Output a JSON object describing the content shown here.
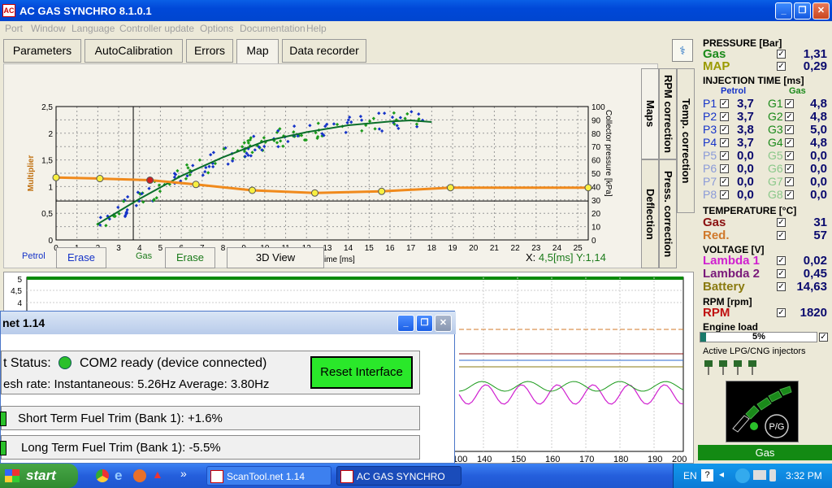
{
  "window": {
    "title": "AC GAS SYNCHRO  8.1.0.1",
    "minimize": "_",
    "maximize": "❐",
    "close": "✕"
  },
  "menu": [
    "Port",
    "Window",
    "Language",
    "Controller update",
    "Options",
    "Documentation",
    "Help"
  ],
  "tabs": [
    "Parameters",
    "AutoCalibration",
    "Errors",
    "Map",
    "Data recorder"
  ],
  "vertical_tabs": {
    "maps": "Maps",
    "rpm": "RPM correction",
    "temp": "Temp. correction",
    "press": "Press. correction",
    "deflection": "Deflection"
  },
  "bottom_controls": {
    "petrol_label": "Petrol",
    "petrol_erase": "Erase",
    "gas_label": "Gas",
    "gas_erase": "Erase",
    "view3d": "3D View",
    "x_label": "X:",
    "x_value": "4,5[ms]",
    "y_value": "Y:1,14"
  },
  "chart_data": {
    "type": "scatter",
    "xlabel": "Injection time [ms]",
    "ylabel": "Multiplier",
    "y2label": "Collector pressure [kPa]",
    "xlim": [
      0,
      25.5
    ],
    "ylim": [
      0,
      2.5
    ],
    "y2lim": [
      0,
      100
    ],
    "x_ticks": [
      0,
      1,
      2,
      3,
      4,
      5,
      6,
      7,
      8,
      9,
      10,
      11,
      12,
      13,
      14,
      15,
      16,
      17,
      18,
      19,
      20,
      21,
      22,
      23,
      24,
      25
    ],
    "y_ticks": [
      "0",
      "0,5",
      "1",
      "1,5",
      "2",
      "2,5"
    ],
    "y2_ticks": [
      0,
      10,
      20,
      30,
      40,
      50,
      60,
      70,
      80,
      90,
      100
    ],
    "multiplier_curve": {
      "x": [
        0,
        2.1,
        4.5,
        6.7,
        9.4,
        12.4,
        15.6,
        18.9,
        25.5
      ],
      "y": [
        1.17,
        1.15,
        1.12,
        1.04,
        0.93,
        0.88,
        0.91,
        0.98,
        0.98
      ],
      "points_x": [
        0,
        2.1,
        4.5,
        6.7,
        9.4,
        12.4,
        15.6,
        18.9,
        25.5
      ],
      "selected_index": 2
    },
    "pressure_curve": {
      "x": [
        2,
        4,
        6,
        8,
        10,
        12,
        14,
        16,
        17,
        18
      ],
      "y": [
        0.3,
        0.77,
        1.2,
        1.55,
        1.85,
        2.02,
        2.15,
        2.22,
        2.24,
        2.21
      ]
    },
    "cursor": {
      "x": 3.7,
      "y": 0.73
    },
    "colors": {
      "multiplier": "#f08a1c",
      "pressure_line": "#0a6e2a",
      "petrol_points": "#1533c8",
      "gas_points": "#1a9a1a"
    }
  },
  "bottom_chart": {
    "y_ticks": [
      "5",
      "4,5",
      "4"
    ],
    "x_ticks": [
      "100",
      "140",
      "150",
      "160",
      "170",
      "180",
      "190",
      "200"
    ]
  },
  "scantool": {
    "title": "net 1.14",
    "status_label": "t Status:",
    "status_text": "COM2 ready (device connected)",
    "refresh": "esh rate: Instantaneous: 5.26Hz    Average: 3.80Hz",
    "reset": "Reset Interface",
    "stft": "Short Term Fuel Trim (Bank 1): +1.6%",
    "ltft": "Long Term Fuel Trim (Bank 1): -5.5%"
  },
  "side": {
    "pressure_header": "PRESSURE [Bar]",
    "pressure": [
      {
        "label": "Gas",
        "value": "1,31",
        "color": "#1a8a1a"
      },
      {
        "label": "MAP",
        "value": "0,29",
        "color": "#9a9a00"
      }
    ],
    "injection_header": "INJECTION TIME [ms]",
    "petrol_col": "Petrol",
    "gas_col": "Gas",
    "injectors": [
      {
        "p": "P1",
        "pv": "3,7",
        "g": "G1",
        "gv": "4,8",
        "on": true
      },
      {
        "p": "P2",
        "pv": "3,7",
        "g": "G2",
        "gv": "4,8",
        "on": true
      },
      {
        "p": "P3",
        "pv": "3,8",
        "g": "G3",
        "gv": "5,0",
        "on": true
      },
      {
        "p": "P4",
        "pv": "3,7",
        "g": "G4",
        "gv": "4,8",
        "on": true
      },
      {
        "p": "P5",
        "pv": "0,0",
        "g": "G5",
        "gv": "0,0",
        "on": false
      },
      {
        "p": "P6",
        "pv": "0,0",
        "g": "G6",
        "gv": "0,0",
        "on": false
      },
      {
        "p": "P7",
        "pv": "0,0",
        "g": "G7",
        "gv": "0,0",
        "on": false
      },
      {
        "p": "P8",
        "pv": "0,0",
        "g": "G8",
        "gv": "0,0",
        "on": false
      }
    ],
    "temperature_header": "TEMPERATURE [°C]",
    "temperature": [
      {
        "label": "Gas",
        "value": "31",
        "color": "#8a1010"
      },
      {
        "label": "Red.",
        "value": "57",
        "color": "#d0782a"
      }
    ],
    "voltage_header": "VOLTAGE [V]",
    "voltage": [
      {
        "label": "Lambda 1",
        "value": "0,02",
        "color": "#d020d0"
      },
      {
        "label": "Lambda 2",
        "value": "0,45",
        "color": "#7a1a7a"
      },
      {
        "label": "Battery",
        "value": "14,63",
        "color": "#8a7a10"
      }
    ],
    "rpm_header": "RPM [rpm]",
    "rpm_label": "RPM",
    "rpm_value": "1820",
    "load_header": "Engine load",
    "load_value": "5%",
    "load_fraction": 0.05,
    "active_header": "Active LPG/CNG injectors",
    "pg": "P/G",
    "status": "Gas"
  },
  "taskbar": {
    "start": "start",
    "tasks": [
      "ScanTool.net 1.14",
      "AC GAS SYNCHRO"
    ],
    "lang": "EN",
    "clock": "3:32 PM",
    "more": "»"
  }
}
